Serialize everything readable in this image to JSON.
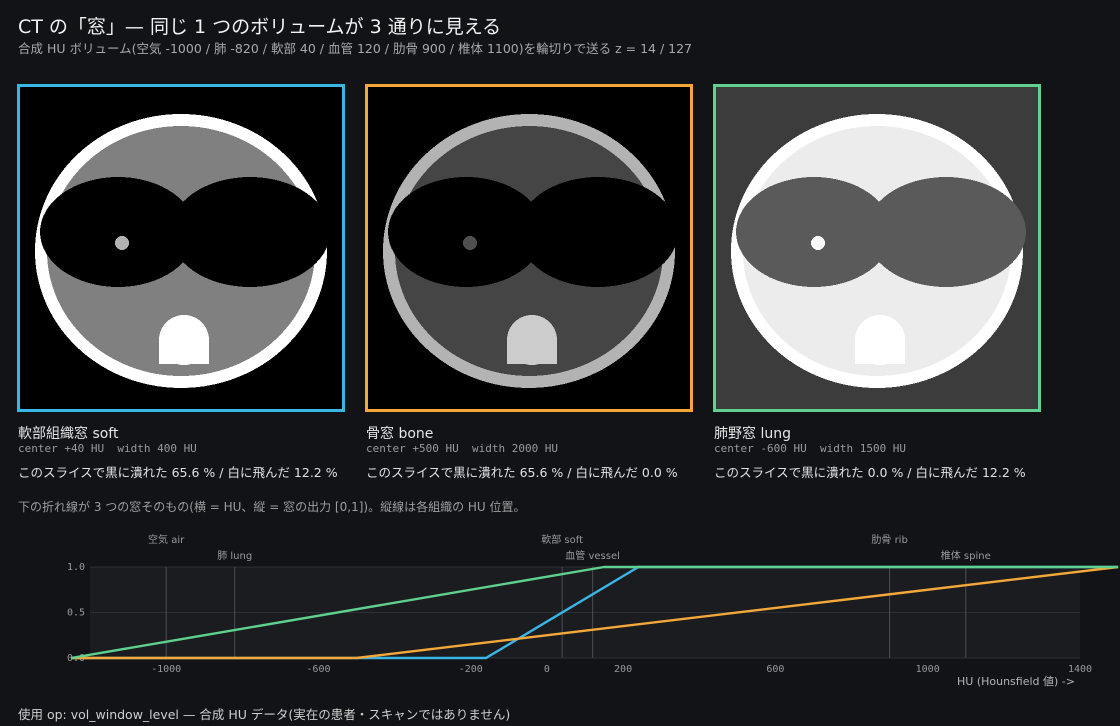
{
  "header": {
    "title": "CT の「窓」— 同じ 1 つのボリュームが 3 通りに見える",
    "subtitle": "合成 HU ボリューム(空気 -1000 / 肺 -820 / 軟部 40 / 血管 120 / 肋骨 900 / 椎体 1100)を輪切りで送る z =  14 / 127"
  },
  "panels": [
    {
      "label": "軟部組織窓 soft",
      "params": "center +40 HU  width 400 HU",
      "stats": "このスライスで黒に潰れた 65.6 % / 白に飛んだ 12.2 %",
      "color": "#39b6e6",
      "center": 40,
      "width": 400
    },
    {
      "label": "骨窓 bone",
      "params": "center +500 HU  width 2000 HU",
      "stats": "このスライスで黒に潰れた 65.6 % / 白に飛んだ 0.0 %",
      "color": "#f5a83a",
      "center": 500,
      "width": 2000
    },
    {
      "label": "肺野窓 lung",
      "params": "center -600 HU  width 1500 HU",
      "stats": "このスライスで黒に潰れた 0.0 % / 白に飛んだ 12.2 %",
      "color": "#5fd08e",
      "center": -600,
      "width": 1500
    }
  ],
  "tissues": {
    "air": -1000,
    "lung": -820,
    "soft": 40,
    "vessel": 120,
    "rib": 900,
    "spine": 1100
  },
  "note": "下の折れ線が 3 つの窓そのもの(横 = HU、縦 = 窓の出力 [0,1])。縦線は各組織の HU 位置。",
  "footer": "使用 op: vol_window_level  — 合成 HU データ(実在の患者・スキャンではありません)",
  "chart_data": {
    "type": "line",
    "xlabel": "HU (Hounsfield 値) ->",
    "xlim": [
      -1250,
      1500
    ],
    "ylim": [
      0,
      1
    ],
    "x_ticks": [
      -1000,
      -600,
      -200,
      0,
      200,
      600,
      1000,
      1400
    ],
    "y_ticks": [
      0.0,
      0.5,
      1.0
    ],
    "grid": true,
    "markers": [
      {
        "name": "空気 air",
        "x": -1000,
        "row": 0
      },
      {
        "name": "肺 lung",
        "x": -820,
        "row": 1
      },
      {
        "name": "軟部 soft",
        "x": 40,
        "row": 0
      },
      {
        "name": "血管 vessel",
        "x": 120,
        "row": 1
      },
      {
        "name": "肋骨 rib",
        "x": 900,
        "row": 0
      },
      {
        "name": "椎体 spine",
        "x": 1100,
        "row": 1
      }
    ],
    "series": [
      {
        "points": [
          [
            -1250,
            0
          ],
          [
            -160,
            0
          ],
          [
            240,
            1
          ],
          [
            1500,
            1
          ]
        ],
        "color": "#39b6e6"
      },
      {
        "points": [
          [
            -1250,
            0
          ],
          [
            -500,
            0
          ],
          [
            1500,
            1
          ]
        ],
        "color": "#f5a83a"
      },
      {
        "points": [
          [
            -1250,
            0
          ],
          [
            150,
            1
          ],
          [
            1500,
            1
          ]
        ],
        "color": "#5fd08e"
      }
    ]
  }
}
